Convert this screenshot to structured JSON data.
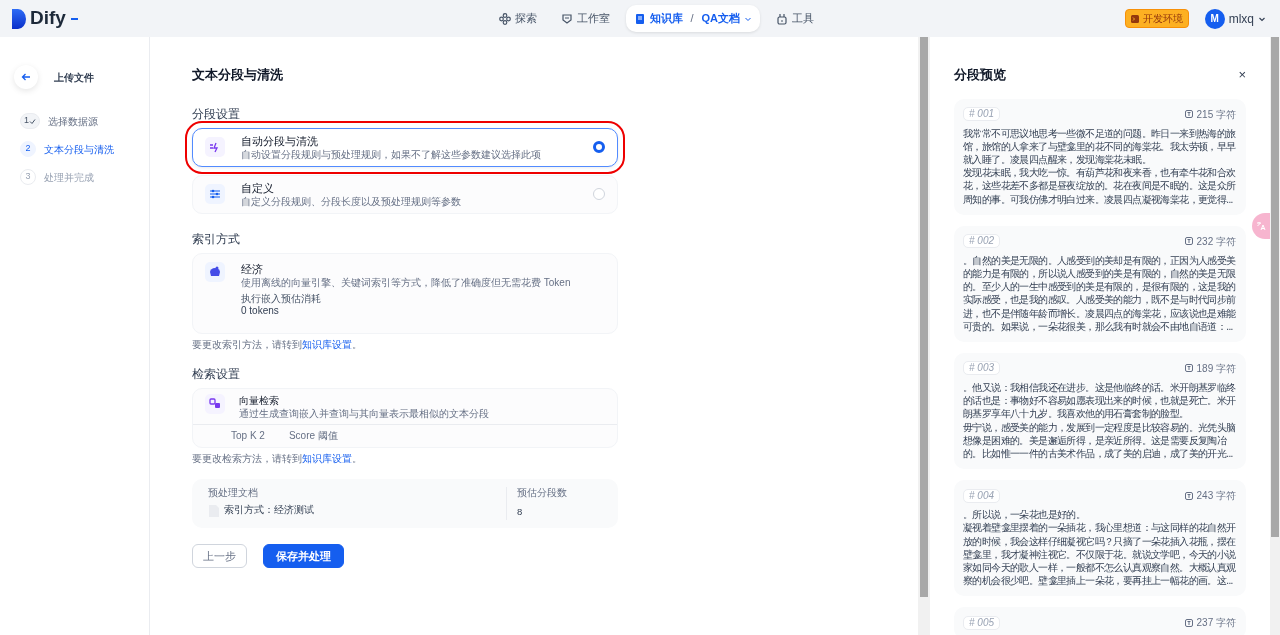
{
  "app": {
    "logo": "Dify"
  },
  "nav": [
    {
      "label": "探索",
      "kind": "explore",
      "selected": false
    },
    {
      "label": "工作室",
      "kind": "studio",
      "selected": false
    },
    {
      "label": "知识库",
      "kind": "knowledge",
      "selected": true,
      "separator": "/",
      "sub": "QA文档"
    },
    {
      "label": "工具",
      "kind": "tools",
      "selected": false
    }
  ],
  "env_badge": "开发环境",
  "user": {
    "initial": "M",
    "name": "mlxq"
  },
  "sidebar": {
    "back_label": "上传文件",
    "steps": [
      {
        "number": "1",
        "label": "选择数据源",
        "completed": true,
        "selected": false
      },
      {
        "number": "2",
        "label": "文本分段与清洗",
        "completed": false,
        "selected": true
      },
      {
        "number": "3",
        "label": "处理并完成",
        "completed": false,
        "selected": false
      }
    ]
  },
  "main": {
    "title": "文本分段与清洗",
    "segment_section": "分段设置",
    "segment_options": [
      {
        "kind": "auto",
        "title": "自动分段与清洗",
        "description": "自动设置分段规则与预处理规则，如果不了解这些参数建议选择此项",
        "selected": true,
        "highlighted": true
      },
      {
        "kind": "custom",
        "title": "自定义",
        "description": "自定义分段规则、分段长度以及预处理规则等参数",
        "selected": false,
        "highlighted": false
      }
    ],
    "index_section": "索引方式",
    "index_card": {
      "title": "经济",
      "description": "使用离线的向量引擎、关键词索引等方式，降低了准确度但无需花费 Token",
      "estimate_label": "执行嵌入预估消耗",
      "estimate_value": "0 tokens"
    },
    "index_note": {
      "text": "要更改索引方法，请转到",
      "link": "知识库设置",
      "end": "。"
    },
    "retrieval_section": "检索设置",
    "retrieval_card": {
      "title": "向量检索",
      "description": "通过生成查询嵌入并查询与其向量表示最相似的文本分段",
      "params": [
        "Top K 2",
        "Score 阈值"
      ]
    },
    "retrieval_note": {
      "text": "要更改检索方法，请转到",
      "link": "知识库设置",
      "end": "。"
    },
    "summary": {
      "doc_label": "预处理文档",
      "doc_name": "索引方式：经济测试",
      "count_label": "预估分段数",
      "count": "8"
    },
    "buttons": [
      {
        "label": "上一步",
        "kind": "secondary"
      },
      {
        "label": "保存并处理",
        "kind": "primary"
      }
    ]
  },
  "preview": {
    "title": "分段预览",
    "close": "×",
    "segments": [
      {
        "id": "# 001",
        "chars": "215 字符",
        "lines": [
          "我常常不可思议地思考一些微不足道的问题。昨日一来到热海的旅",
          "馆，旅馆的人拿来了与壁龛里的花不同的海棠花。我太劳顿，早早",
          "就入睡了。凌晨四点醒来，发现海棠花未眠。",
          "发现花未眠，我大吃一惊。有葫芦花和夜来香，也有牵牛花和合欢",
          "花，这些花差不多都是昼夜绽放的。花在夜间是不眠的。这是众所",
          "周知的事。可我仿佛才明白过来。凌晨四点凝视海棠花，更觉得..."
        ]
      },
      {
        "id": "# 002",
        "chars": "232 字符",
        "lines": [
          "。自然的美是无限的。人感受到的美却是有限的，正因为人感受美",
          "的能力是有限的，所以说人感受到的美是有限的，自然的美是无限",
          "的。至少人的一生中感受到的美是有限的，是很有限的，这是我的",
          "实际感受，也是我的感叹。人感受美的能力，既不是与时代同步前",
          "进，也不是伴随年龄而增长。凌晨四点的海棠花，应该说也是难能",
          "可贵的。如果说，一朵花很美，那么我有时就会不由地自语道：..."
        ]
      },
      {
        "id": "# 003",
        "chars": "189 字符",
        "lines": [
          "。他又说：我相信我还在进步。这是他临终的话。米开朗基罗临终",
          "的话也是：事物好不容易如愿表现出来的时候，也就是死亡。米开",
          "朗基罗享年八十九岁。我喜欢他的用石膏套制的脸型。",
          "毋宁说，感受美的能力，发展到一定程度是比较容易的。光凭头脑",
          "想像是困难的。美是邂逅所得，是亲近所得。这是需要反复陶冶",
          "的。比如惟一一件的古美术作品，成了美的启迪，成了美的开光..."
        ]
      },
      {
        "id": "# 004",
        "chars": "243 字符",
        "lines": [
          "。所以说，一朵花也是好的。",
          "凝视着壁龛里摆着的一朵插花，我心里想道：与这同样的花自然开",
          "放的时候，我会这样仔细凝视它吗？只摘了一朵花插入花瓶，摆在",
          "壁龛里，我才凝神注视它。不仅限于花。就说文学吧，今天的小说",
          "家如同今天的歌人一样，一般都不怎么认真观察自然。大概认真观",
          "察的机会很少吧。壁龛里插上一朵花，要再挂上一幅花的画。这..."
        ]
      },
      {
        "id": "# 005",
        "chars": "237 字符"
      }
    ]
  }
}
